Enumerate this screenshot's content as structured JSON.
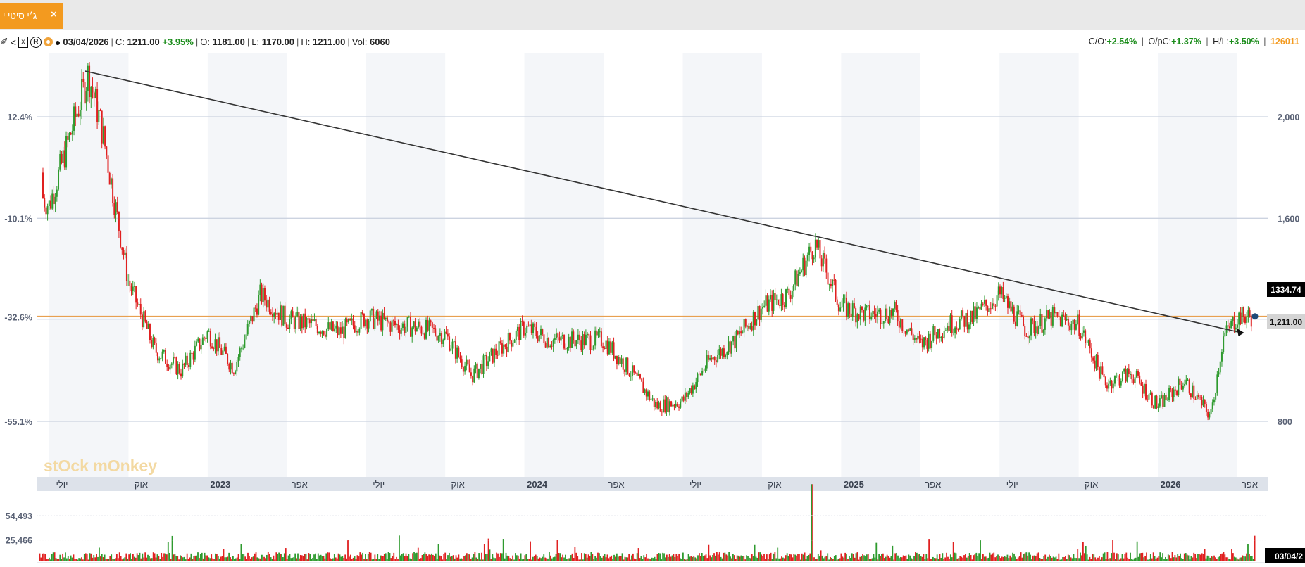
{
  "tab": {
    "label": "ג׳י סיטי י",
    "close": "×"
  },
  "infobar": {
    "date": "03/04/2026",
    "close_label": "C:",
    "close_value": "1211.00",
    "change": "+3.95%",
    "open_label": "O:",
    "open_value": "1181.00",
    "low_label": "L:",
    "low_value": "1170.00",
    "high_label": "H:",
    "high_value": "1211.00",
    "vol_label": "Vol:",
    "vol_value": "6060",
    "co_label": "C/O:",
    "co_value": "+2.54%",
    "opc_label": "O/pC:",
    "opc_value": "+1.37%",
    "hl_label": "H/L:",
    "hl_value": "+3.50%",
    "symbol_code": "126011"
  },
  "watermark": "stOck mOnkey",
  "colors": {
    "up": "#2e9a2e",
    "down": "#e02020",
    "trendline": "#333333",
    "hline": "#e8a050",
    "accent": "#f39a1f"
  },
  "icons": [
    "wrench-icon",
    "share-icon",
    "excel-icon",
    "registered-icon",
    "target-icon",
    "comment-icon"
  ],
  "chart_data": {
    "type": "candlestick",
    "price_axis": {
      "ticks": [
        "2,000",
        "1,600",
        "800"
      ],
      "tick_values": [
        2000,
        1600,
        800
      ],
      "range": [
        540,
        2330
      ]
    },
    "percent_axis": {
      "ticks": [
        "12.4%",
        "-10.1%",
        "-32.6%",
        "-55.1%"
      ]
    },
    "x_axis": {
      "labels": [
        "יולי",
        "אוק",
        "2023",
        "אפר",
        "יולי",
        "אוק",
        "2024",
        "אפר",
        "יולי",
        "אוק",
        "2025",
        "אפר",
        "יולי",
        "אוק",
        "2026",
        "אפר"
      ]
    },
    "price_labels": {
      "marker_value": "1334.74",
      "last_value": "1,211.00"
    },
    "horizontal_line_value": 1211,
    "trendline": {
      "start": {
        "date": "2022-08",
        "price": 2180
      },
      "end": {
        "date": "2026-04",
        "price": 1152
      }
    },
    "price_path": [
      [
        "2022-06",
        1780
      ],
      [
        "2022-07",
        1650
      ],
      [
        "2022-08",
        2000
      ],
      [
        "2022-08b",
        2170
      ],
      [
        "2022-09",
        1950
      ],
      [
        "2022-10",
        1350
      ],
      [
        "2022-11",
        1080
      ],
      [
        "2022-12",
        1000
      ],
      [
        "2023-01",
        1150
      ],
      [
        "2023-02",
        1010
      ],
      [
        "2023-03",
        1300
      ],
      [
        "2023-04",
        1200
      ],
      [
        "2023-05",
        1180
      ],
      [
        "2023-06",
        1150
      ],
      [
        "2023-07",
        1210
      ],
      [
        "2023-08",
        1180
      ],
      [
        "2023-09",
        1170
      ],
      [
        "2023-10",
        1140
      ],
      [
        "2023-11",
        980
      ],
      [
        "2023-12",
        1080
      ],
      [
        "2024-01",
        1170
      ],
      [
        "2024-02",
        1120
      ],
      [
        "2024-03",
        1120
      ],
      [
        "2024-04",
        1120
      ],
      [
        "2024-05",
        1000
      ],
      [
        "2024-06",
        860
      ],
      [
        "2024-07",
        880
      ],
      [
        "2024-08",
        1040
      ],
      [
        "2024-09",
        1120
      ],
      [
        "2024-10",
        1250
      ],
      [
        "2024-11",
        1300
      ],
      [
        "2024-12",
        1500
      ],
      [
        "2025-01",
        1250
      ],
      [
        "2025-02",
        1220
      ],
      [
        "2025-03",
        1230
      ],
      [
        "2025-04",
        1100
      ],
      [
        "2025-05",
        1180
      ],
      [
        "2025-06",
        1210
      ],
      [
        "2025-07",
        1300
      ],
      [
        "2025-08",
        1160
      ],
      [
        "2025-09",
        1210
      ],
      [
        "2025-10",
        1180
      ],
      [
        "2025-11",
        950
      ],
      [
        "2025-12",
        990
      ],
      [
        "2026-01",
        860
      ],
      [
        "2026-02",
        960
      ],
      [
        "2026-03",
        820
      ],
      [
        "2026-03b",
        1130
      ],
      [
        "2026-04",
        1211
      ]
    ],
    "volume_axis": {
      "ticks": [
        "54,493",
        "25,466"
      ],
      "tick_values": [
        54493,
        25466
      ]
    },
    "volume_date_label": "03/04/2"
  }
}
